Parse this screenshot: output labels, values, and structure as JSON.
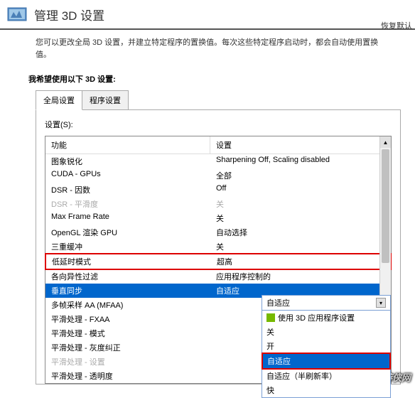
{
  "header": {
    "title": "管理 3D 设置",
    "restore": "恢复默认"
  },
  "description": "您可以更改全局 3D 设置，并建立特定程序的置换值。每次这些特定程序启动时，都会自动使用置换值。",
  "section": "我希望使用以下 3D 设置:",
  "tabs": {
    "global": "全局设置",
    "program": "程序设置"
  },
  "settingLabel": "设置(S):",
  "columns": {
    "func": "功能",
    "setting": "设置"
  },
  "rows": [
    {
      "func": "图象锐化",
      "setting": "Sharpening Off, Scaling disabled"
    },
    {
      "func": "CUDA - GPUs",
      "setting": "全部"
    },
    {
      "func": "DSR - 因数",
      "setting": "Off"
    },
    {
      "func": "DSR - 平滑度",
      "setting": "关",
      "disabled": true
    },
    {
      "func": "Max Frame Rate",
      "setting": "关"
    },
    {
      "func": "OpenGL 渲染 GPU",
      "setting": "自动选择"
    },
    {
      "func": "三重缓冲",
      "setting": "关"
    },
    {
      "func": "低延时模式",
      "setting": "超高",
      "redbox": true
    },
    {
      "func": "各向异性过滤",
      "setting": "应用程序控制的"
    },
    {
      "func": "垂直同步",
      "setting": "自适应",
      "selected": true
    },
    {
      "func": "多帧采样 AA (MFAA)",
      "setting": ""
    },
    {
      "func": "平滑处理 - FXAA",
      "setting": ""
    },
    {
      "func": "平滑处理 - 模式",
      "setting": ""
    },
    {
      "func": "平滑处理 - 灰度纠正",
      "setting": ""
    },
    {
      "func": "平滑处理 - 设置",
      "setting": "",
      "disabled": true
    },
    {
      "func": "平滑处理 - 透明度",
      "setting": ""
    }
  ],
  "dropdown": {
    "current": "自适应",
    "items": [
      {
        "label": "使用 3D 应用程序设置",
        "icon": true
      },
      {
        "label": "关"
      },
      {
        "label": "开"
      },
      {
        "label": "自适应",
        "selected": true
      },
      {
        "label": "自适应（半刷新率）"
      },
      {
        "label": "快"
      }
    ]
  },
  "watermark": "游侠网"
}
